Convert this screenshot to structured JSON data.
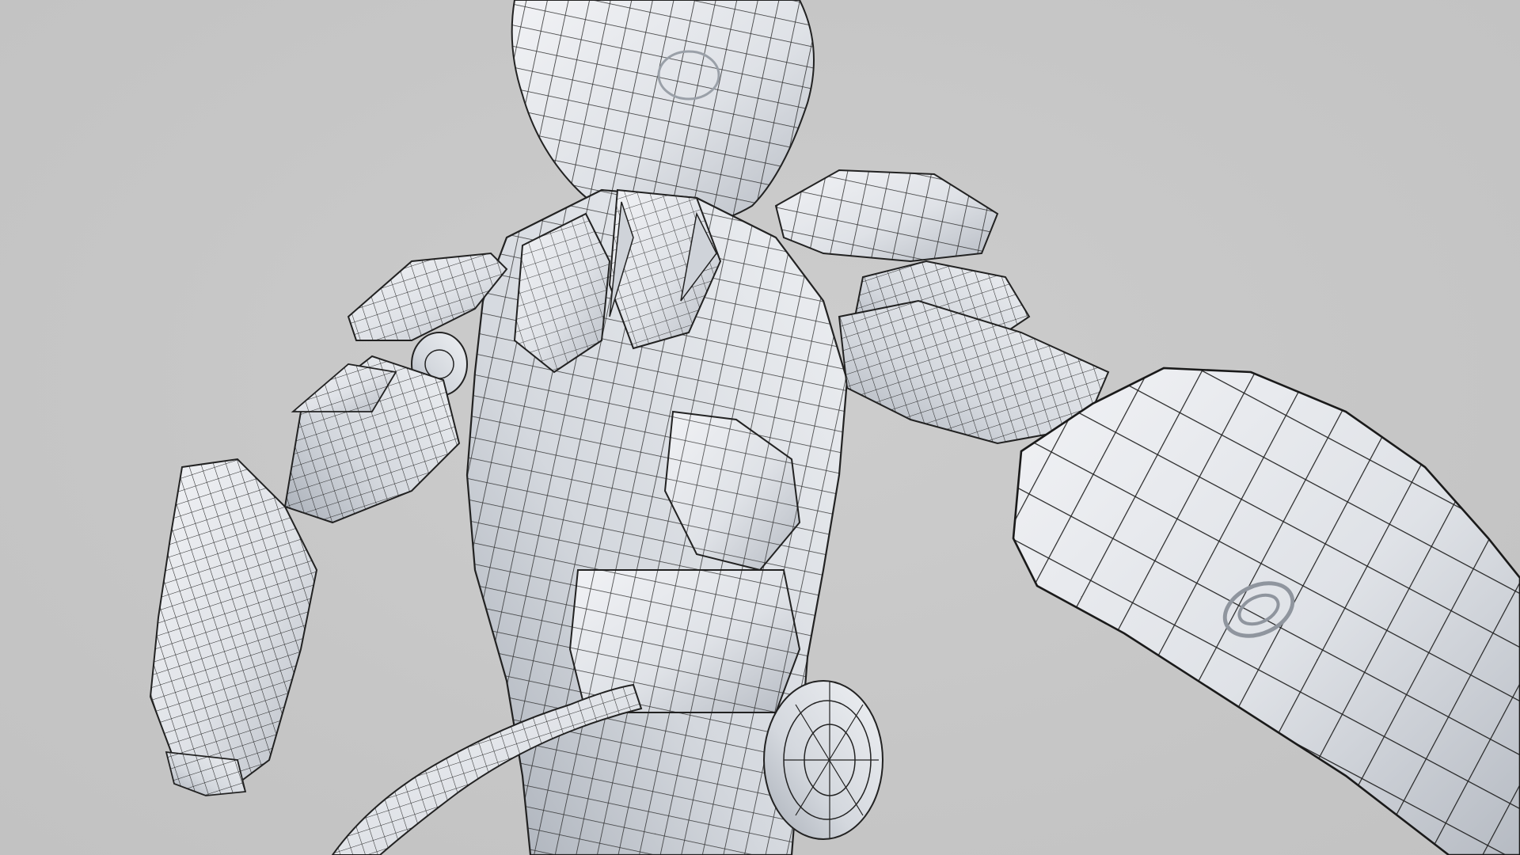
{
  "scene": {
    "subject": "wireframe-robot-render",
    "colors": {
      "background": "#c7c7c7",
      "mesh_fill": "#e6e8ec",
      "mesh_shade": "#aeb3bb",
      "wire": "#1a1a1a"
    }
  }
}
